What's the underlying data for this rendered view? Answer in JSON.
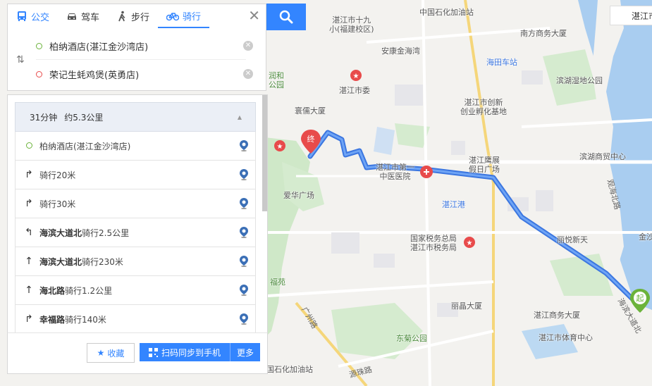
{
  "modes": [
    {
      "label": "公交",
      "icon": "bus-icon"
    },
    {
      "label": "驾车",
      "icon": "car-icon"
    },
    {
      "label": "步行",
      "icon": "walk-icon"
    },
    {
      "label": "骑行",
      "icon": "bike-icon"
    }
  ],
  "active_mode": "骑行",
  "route": {
    "start": "柏纳酒店(湛江金沙湾店)",
    "end": "荣记生蚝鸡煲(英勇店)"
  },
  "summary": {
    "duration": "31分钟",
    "distance": "约5.3公里"
  },
  "steps": [
    {
      "icon": "start-dot-icon",
      "road": "",
      "text": "柏纳酒店(湛江金沙湾店)"
    },
    {
      "icon": "turn-right-icon",
      "road": "",
      "text": "骑行20米"
    },
    {
      "icon": "turn-right-icon",
      "road": "",
      "text": "骑行30米"
    },
    {
      "icon": "turn-left-icon",
      "road": "海滨大道北",
      "text": "骑行2.5公里"
    },
    {
      "icon": "straight-icon",
      "road": "海滨大道北",
      "text": "骑行230米"
    },
    {
      "icon": "straight-icon",
      "road": "海北路",
      "text": "骑行1.2公里"
    },
    {
      "icon": "turn-right-icon",
      "road": "幸福路",
      "text": "骑行140米"
    }
  ],
  "footer": {
    "fav": "收藏",
    "qr": "扫码同步到手机",
    "more": "更多"
  },
  "city": "湛江市",
  "map_labels": {
    "school": "湛江市十九\n小(福建校区)",
    "sinopec_top": "中国石化加油站",
    "nanfang": "南方商务大厦",
    "jinshawan": "安康金海湾",
    "haitian": "海田车站",
    "park": "润和\n公园",
    "shiwei": "湛江市委",
    "binhu_park": "滨湖湿地公园",
    "huanru": "寰儒大厦",
    "chuangxin": "湛江市创新\n创业孵化基地",
    "binhu_center": "滨湖商贸中心",
    "hospital": "湛江市第一\n中医医院",
    "yingzhan": "湛江鹰展\n假日广场",
    "aihua": "爱华广场",
    "zhanjianggang": "湛江港",
    "tax": "国家税务总局\n湛江市税务局",
    "liyue": "丽悦新天",
    "fuyuan": "福苑",
    "lijing": "丽晶大厦",
    "shangwu": "湛江商务大厦",
    "tiyu": "湛江市体育中心",
    "dongju": "东菊公园",
    "sinopec_bottom": "国石化加油站",
    "road_guangzhou": "广州路",
    "road_yuanzhu": "源珠路",
    "road_haibin": "海滨大道北",
    "road_guanhai": "观海北路",
    "jinsha_right": "金沙",
    "start_marker": "起",
    "end_marker": "终"
  }
}
